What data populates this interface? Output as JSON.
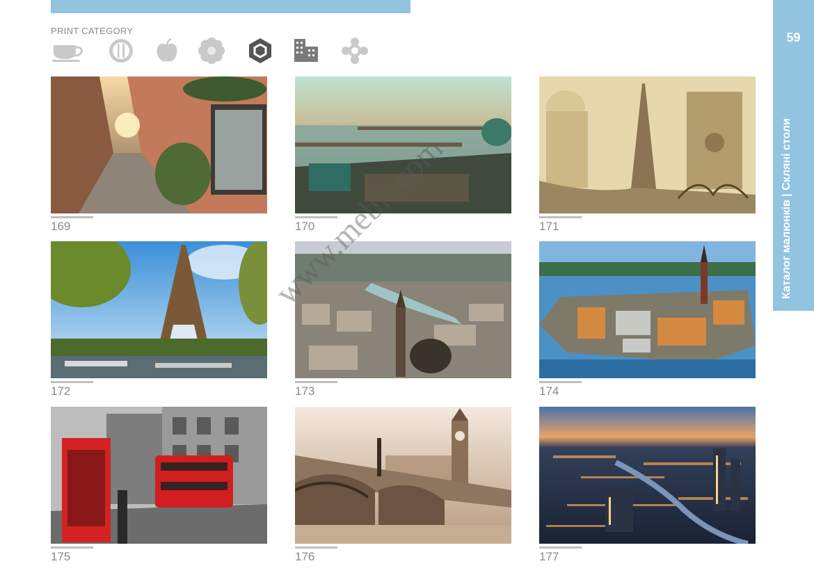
{
  "header": {
    "category_label": "PRINT CATEGORY"
  },
  "side_tab": {
    "page_number": "59",
    "title": "Каталог малюнків | Скляні столи"
  },
  "category_icons": [
    {
      "icon": "cup-icon",
      "active": false
    },
    {
      "icon": "plate-cutlery-icon",
      "active": false
    },
    {
      "icon": "apple-icon",
      "active": false
    },
    {
      "icon": "flower-icon",
      "active": false
    },
    {
      "icon": "hexagon-icon",
      "active": true
    },
    {
      "icon": "buildings-icon",
      "active": false
    },
    {
      "icon": "ornament-icon",
      "active": false
    }
  ],
  "tiles": [
    {
      "number": "169"
    },
    {
      "number": "170"
    },
    {
      "number": "171"
    },
    {
      "number": "172"
    },
    {
      "number": "173"
    },
    {
      "number": "174"
    },
    {
      "number": "175"
    },
    {
      "number": "176"
    },
    {
      "number": "177"
    }
  ],
  "watermark": "www.mebli.com",
  "colors": {
    "accent": "#92c3df",
    "icon_inactive": "#c9c9c9",
    "icon_active": "#555555"
  }
}
